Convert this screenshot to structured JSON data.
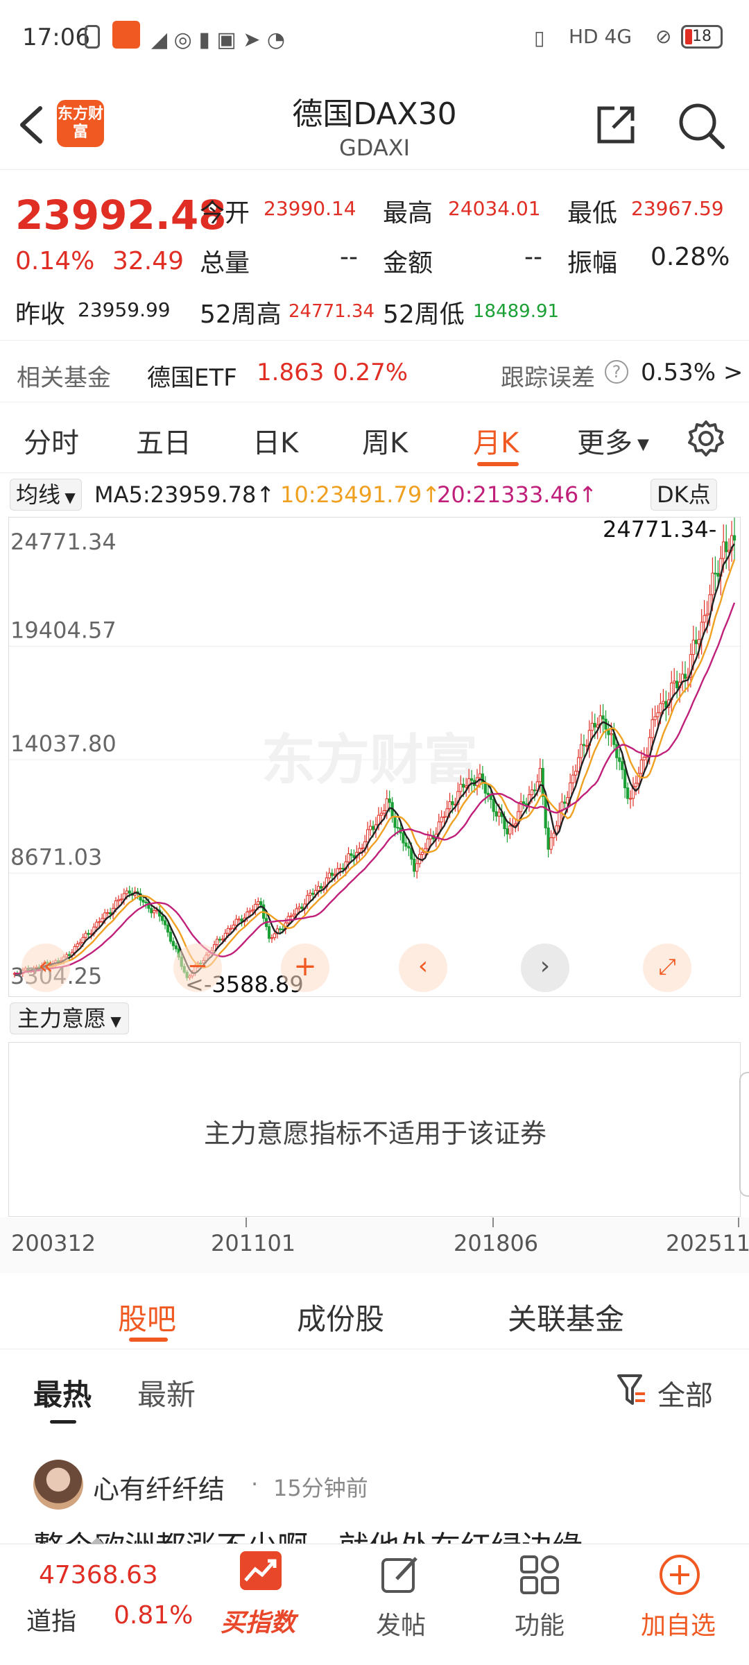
{
  "status_bar": {
    "time": "17:06",
    "network": "HD 4G",
    "battery": "18"
  },
  "header": {
    "logo_text": "东方财富",
    "title": "德国DAX30",
    "code": "GDAXI"
  },
  "quote": {
    "price": "23992.48",
    "change_pct": "0.14%",
    "change": "32.49",
    "prev_close_label": "昨收",
    "prev_close": "23959.99",
    "open_label": "今开",
    "open": "23990.14",
    "high_label": "最高",
    "high": "24034.01",
    "low_label": "最低",
    "low": "23967.59",
    "volume_label": "总量",
    "volume": "--",
    "amount_label": "金额",
    "amount": "--",
    "amplitude_label": "振幅",
    "amplitude": "0.28%",
    "wk52_high_label": "52周高",
    "wk52_high": "24771.34",
    "wk52_low_label": "52周低",
    "wk52_low": "18489.91"
  },
  "fund": {
    "label": "相关基金",
    "name": "德国ETF",
    "price": "1.863",
    "pct": "0.27%",
    "tracking_label": "跟踪误差",
    "tracking_value": "0.53% >"
  },
  "ktabs": [
    "分时",
    "五日",
    "日K",
    "周K",
    "月K",
    "更多"
  ],
  "ma": {
    "selector": "均线",
    "ma5": "MA5:23959.78↑",
    "ma10": "10:23491.79↑",
    "ma20": "20:21333.46↑",
    "dk": "DK点"
  },
  "chart_data": {
    "type": "candlestick",
    "period": "monthly",
    "y_ticks": [
      "24771.34",
      "19404.57",
      "14037.80",
      "8671.03",
      "3304.25"
    ],
    "ylim": [
      3304.25,
      24771.34
    ],
    "max_label": "24771.34-",
    "min_label": "<-3588.89",
    "watermark": "东方财富",
    "x_ticks": [
      "200312",
      "201101",
      "201806",
      "202511"
    ],
    "close_path_estimate": [
      {
        "date": "2003-12",
        "value": 3900
      },
      {
        "date": "2005-06",
        "value": 4600
      },
      {
        "date": "2007-06",
        "value": 7900
      },
      {
        "date": "2008-06",
        "value": 6500
      },
      {
        "date": "2009-03",
        "value": 3700
      },
      {
        "date": "2010-06",
        "value": 6000
      },
      {
        "date": "2011-06",
        "value": 7300
      },
      {
        "date": "2011-09",
        "value": 5500
      },
      {
        "date": "2012-12",
        "value": 7600
      },
      {
        "date": "2014-06",
        "value": 9800
      },
      {
        "date": "2015-04",
        "value": 12000
      },
      {
        "date": "2016-02",
        "value": 9000
      },
      {
        "date": "2017-06",
        "value": 12500
      },
      {
        "date": "2018-01",
        "value": 13300
      },
      {
        "date": "2018-12",
        "value": 10600
      },
      {
        "date": "2019-12",
        "value": 13250
      },
      {
        "date": "2020-03",
        "value": 9900
      },
      {
        "date": "2021-06",
        "value": 15500
      },
      {
        "date": "2021-12",
        "value": 15900
      },
      {
        "date": "2022-09",
        "value": 12100
      },
      {
        "date": "2023-07",
        "value": 16400
      },
      {
        "date": "2024-06",
        "value": 18300
      },
      {
        "date": "2025-03",
        "value": 22200
      },
      {
        "date": "2025-07",
        "value": 24200
      },
      {
        "date": "2025-11",
        "value": 23992
      }
    ]
  },
  "indicator": {
    "selector": "主力意愿",
    "message": "主力意愿指标不适用于该证券"
  },
  "community_tabs": [
    "股吧",
    "成份股",
    "关联基金"
  ],
  "sub_tabs": {
    "hot": "最热",
    "new": "最新",
    "filter": "全部"
  },
  "post": {
    "author": "心有纤纤结",
    "time": "15分钟前",
    "text": "整个欧洲都涨不少啊，就他处在红绿边缘"
  },
  "bottom_bar": {
    "index_value": "47368.63",
    "index_name": "道指",
    "index_pct": "0.81%",
    "items": [
      "买指数",
      "发帖",
      "功能",
      "加自选"
    ]
  },
  "colors": {
    "up": "#e02e24",
    "down": "#1aa034",
    "accent": "#f05a22",
    "ma5": "#222222",
    "ma10": "#f0a020",
    "ma20": "#c0207a"
  }
}
